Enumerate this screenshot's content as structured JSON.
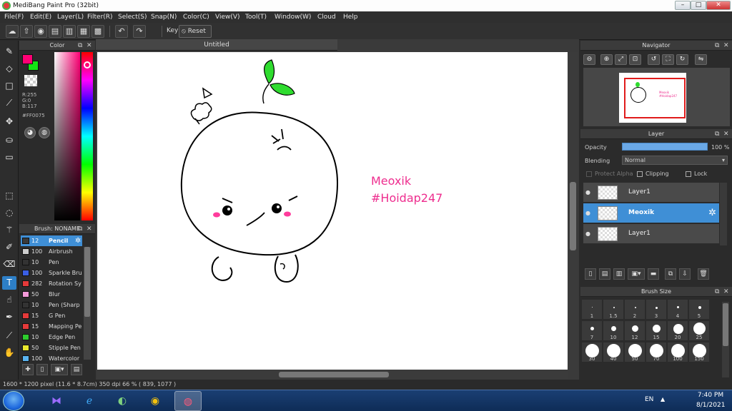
{
  "window": {
    "title": "MediBang Paint Pro (32bit)",
    "min": "–",
    "max": "□",
    "close": "✕"
  },
  "menu": [
    "File(F)",
    "Edit(E)",
    "Layer(L)",
    "Filter(R)",
    "Select(S)",
    "Snap(N)",
    "Color(C)",
    "View(V)",
    "Tool(T)",
    "Window(W)",
    "Cloud",
    "Help"
  ],
  "toolbar": {
    "icons": [
      "cloud-icon",
      "share-icon",
      "comment-icon",
      "chat-icon",
      "page-icon",
      "layout-icon",
      "grid-icon"
    ],
    "undo_icon": "undo-icon",
    "redo_icon": "redo-icon",
    "key_label": "Key",
    "reset_label": "Reset"
  },
  "tools": [
    "brush",
    "eraser",
    "rectangle",
    "fill-line",
    "move",
    "bucket",
    "gradient",
    "select-rect",
    "lasso",
    "magic-wand",
    "select-pen",
    "select-eraser",
    "text",
    "operation",
    "eyedropper",
    "hand-divide",
    "hand"
  ],
  "color_panel": {
    "title": "Color",
    "fg": "#FF0075",
    "bg": "#13E313",
    "r": "R:255",
    "g": "G:0",
    "b": "B:117",
    "hex": "#FF0075"
  },
  "brush_panel": {
    "title": "Brush: NONAME",
    "brushes": [
      {
        "size": "12",
        "name": "Pencil",
        "color": "#3a3a3a"
      },
      {
        "size": "100",
        "name": "Airbrush",
        "color": "#cccccc"
      },
      {
        "size": "10",
        "name": "Pen",
        "color": "#333333"
      },
      {
        "size": "100",
        "name": "Sparkle Brus",
        "color": "#3a5fe5"
      },
      {
        "size": "282",
        "name": "Rotation Sy",
        "color": "#e53a3a"
      },
      {
        "size": "50",
        "name": "Blur",
        "color": "#f39ad9"
      },
      {
        "size": "10",
        "name": "Pen (Sharp",
        "color": "#333333"
      },
      {
        "size": "15",
        "name": "G Pen",
        "color": "#e53a3a"
      },
      {
        "size": "15",
        "name": "Mapping Pe",
        "color": "#e53a3a"
      },
      {
        "size": "10",
        "name": "Edge Pen",
        "color": "#2ecc2e"
      },
      {
        "size": "50",
        "name": "Stipple Pen",
        "color": "#e8e82e"
      },
      {
        "size": "100",
        "name": "Watercolor",
        "color": "#5ab4f0"
      }
    ]
  },
  "document": {
    "tab": "Untitled",
    "text_line1": "Meoxik",
    "text_line2": "#Hoidap247"
  },
  "navigator": {
    "title": "Navigator",
    "thumb_text": "Meoxik #Hoidap247"
  },
  "layer_panel": {
    "title": "Layer",
    "opacity_label": "Opacity",
    "opacity_value": "100 %",
    "opacity": 1.0,
    "blending_label": "Blending",
    "blending_value": "Normal",
    "protect_alpha": "Protect Alpha",
    "clipping": "Clipping",
    "lock": "Lock",
    "layers": [
      {
        "name": "Layer1",
        "selected": false
      },
      {
        "name": "Meoxik",
        "selected": true
      },
      {
        "name": "Layer1",
        "selected": false
      }
    ]
  },
  "brush_size_panel": {
    "title": "Brush Size",
    "sizes": [
      "1",
      "1.5",
      "2",
      "3",
      "4",
      "5",
      "7",
      "10",
      "12",
      "15",
      "20",
      "25",
      "30",
      "40",
      "50",
      "70",
      "100",
      "150"
    ]
  },
  "status": {
    "text": "1600 * 1200 pixel   (11.6 * 8.7cm)   350 dpi   66 %   ( 839, 1077 )"
  },
  "taskbar": {
    "apps": [
      "visual-studio-icon",
      "internet-explorer-icon",
      "coccoc-icon",
      "chrome-icon",
      "medibang-icon"
    ],
    "lang": "EN",
    "time": "7:40 PM",
    "date": "8/1/2021"
  }
}
